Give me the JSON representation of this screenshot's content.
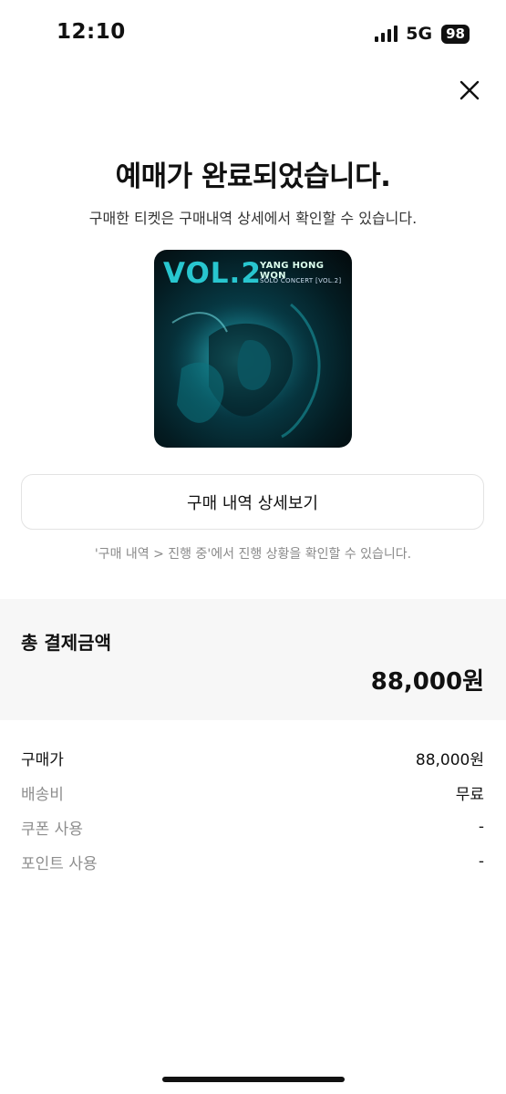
{
  "status_bar": {
    "time": "12:10",
    "network": "5G",
    "battery": "98"
  },
  "icons": {
    "close": "close-icon",
    "signal": "signal-icon"
  },
  "main": {
    "title": "예매가 완료되었습니다.",
    "subtitle": "구매한 티켓은 구매내역 상세에서 확인할 수 있습니다.",
    "poster": {
      "vol": "VOL.2",
      "artist": "YANG HONG WON",
      "concert": "SOLO CONCERT [VOL.2]"
    },
    "detail_button": "구매 내역 상세보기",
    "hint": "'구매 내역 > 진행 중'에서 진행 상황을 확인할 수 있습니다."
  },
  "total": {
    "label": "총 결제금액",
    "amount": "88,000원"
  },
  "breakdown": [
    {
      "label": "구매가",
      "value": "88,000원"
    },
    {
      "label": "배송비",
      "value": "무료"
    },
    {
      "label": "쿠폰 사용",
      "value": "-"
    },
    {
      "label": "포인트 사용",
      "value": "-"
    }
  ],
  "colors": {
    "accent_poster": "#28c6cf",
    "section_bg": "#f7f7f7",
    "muted_text": "#8e8e8e"
  }
}
